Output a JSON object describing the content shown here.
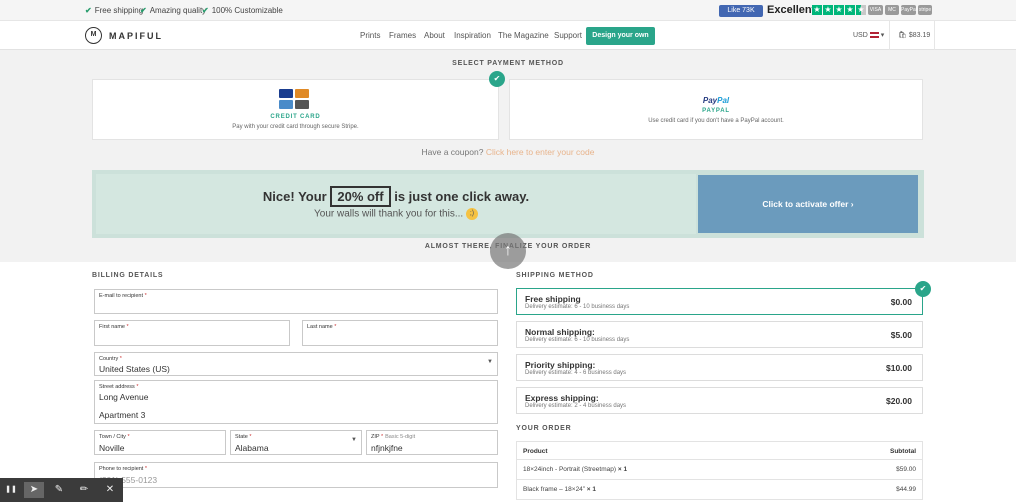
{
  "topbar": {
    "usps": [
      "Free shipping",
      "Amazing quality",
      "100% Customizable"
    ],
    "fb_like": "Like 73K",
    "rating": "Excellent",
    "pay_logos": [
      "VISA",
      "MC",
      "PayPal",
      "stripe"
    ]
  },
  "nav": {
    "logo_mark": "M",
    "logo": "MAPIFUL",
    "links": [
      "Prints",
      "Frames",
      "About",
      "Inspiration",
      "The Magazine",
      "Support"
    ],
    "design_button": "Design your own",
    "currency": "USD",
    "cart_total": "$83.19"
  },
  "payment": {
    "title": "SELECT PAYMENT METHOD",
    "credit_card": {
      "label": "CREDIT CARD",
      "desc": "Pay with your credit card through secure Stripe."
    },
    "paypal": {
      "logo_pay": "Pay",
      "logo_pal": "Pal",
      "label": "PAYPAL",
      "desc": "Use credit card if you don't have a PayPal account."
    },
    "coupon_prefix": "Have a coupon?",
    "coupon_link": "Click here to enter your code"
  },
  "offer": {
    "headline_pre": "Nice! Your",
    "headline_box": "20% off",
    "headline_post": "is just one click away.",
    "sub": "Your walls will thank you for this...",
    "activate": "Click to activate offer ›"
  },
  "checkout": {
    "title": "ALMOST THERE, FINALIZE YOUR ORDER"
  },
  "billing": {
    "title": "BILLING DETAILS",
    "email_label": "E-mail to recipient",
    "first_name_label": "First name",
    "last_name_label": "Last name",
    "country_label": "Country",
    "country_value": "United States (US)",
    "street_label": "Street address",
    "street_value": "Long Avenue",
    "street2_value": "Apartment 3",
    "city_label": "Town / City",
    "city_value": "Noville",
    "state_label": "State",
    "state_value": "Alabama",
    "zip_label": "ZIP",
    "zip_hint": "Basic 5-digit",
    "zip_value": "nfjnkjfne",
    "phone_label": "Phone to recipient",
    "phone_placeholder": "(201) 555-0123",
    "req": "*"
  },
  "shipping": {
    "title": "SHIPPING METHOD",
    "options": [
      {
        "name": "Free shipping",
        "est": "Delivery estimate: 6 - 10 business days",
        "price": "$0.00"
      },
      {
        "name": "Normal shipping:",
        "est": "Delivery estimate: 6 - 10 business days",
        "price": "$5.00"
      },
      {
        "name": "Priority shipping:",
        "est": "Delivery estimate: 4 - 6 business days",
        "price": "$10.00"
      },
      {
        "name": "Express shipping:",
        "est": "Delivery estimate: 2 - 4 business days",
        "price": "$20.00"
      }
    ]
  },
  "order": {
    "title": "YOUR ORDER",
    "col_product": "Product",
    "col_subtotal": "Subtotal",
    "rows": [
      {
        "product": "18×24inch - Portrait (Streetmap)",
        "qty": "× 1",
        "subtotal": "$59.00"
      },
      {
        "product": "Black frame – 18×24”",
        "qty": "× 1",
        "subtotal": "$44.99"
      }
    ]
  },
  "icons": {
    "check": "✔",
    "pause": "❚❚",
    "pointer": "➤",
    "pen": "✎",
    "highlighter": "✏",
    "close": "✕"
  },
  "colors": {
    "accent": "#2aa58a",
    "offer_bg": "#cce1da",
    "activate_bg": "#6b9bbd",
    "coupon_link": "#e8b48c"
  }
}
